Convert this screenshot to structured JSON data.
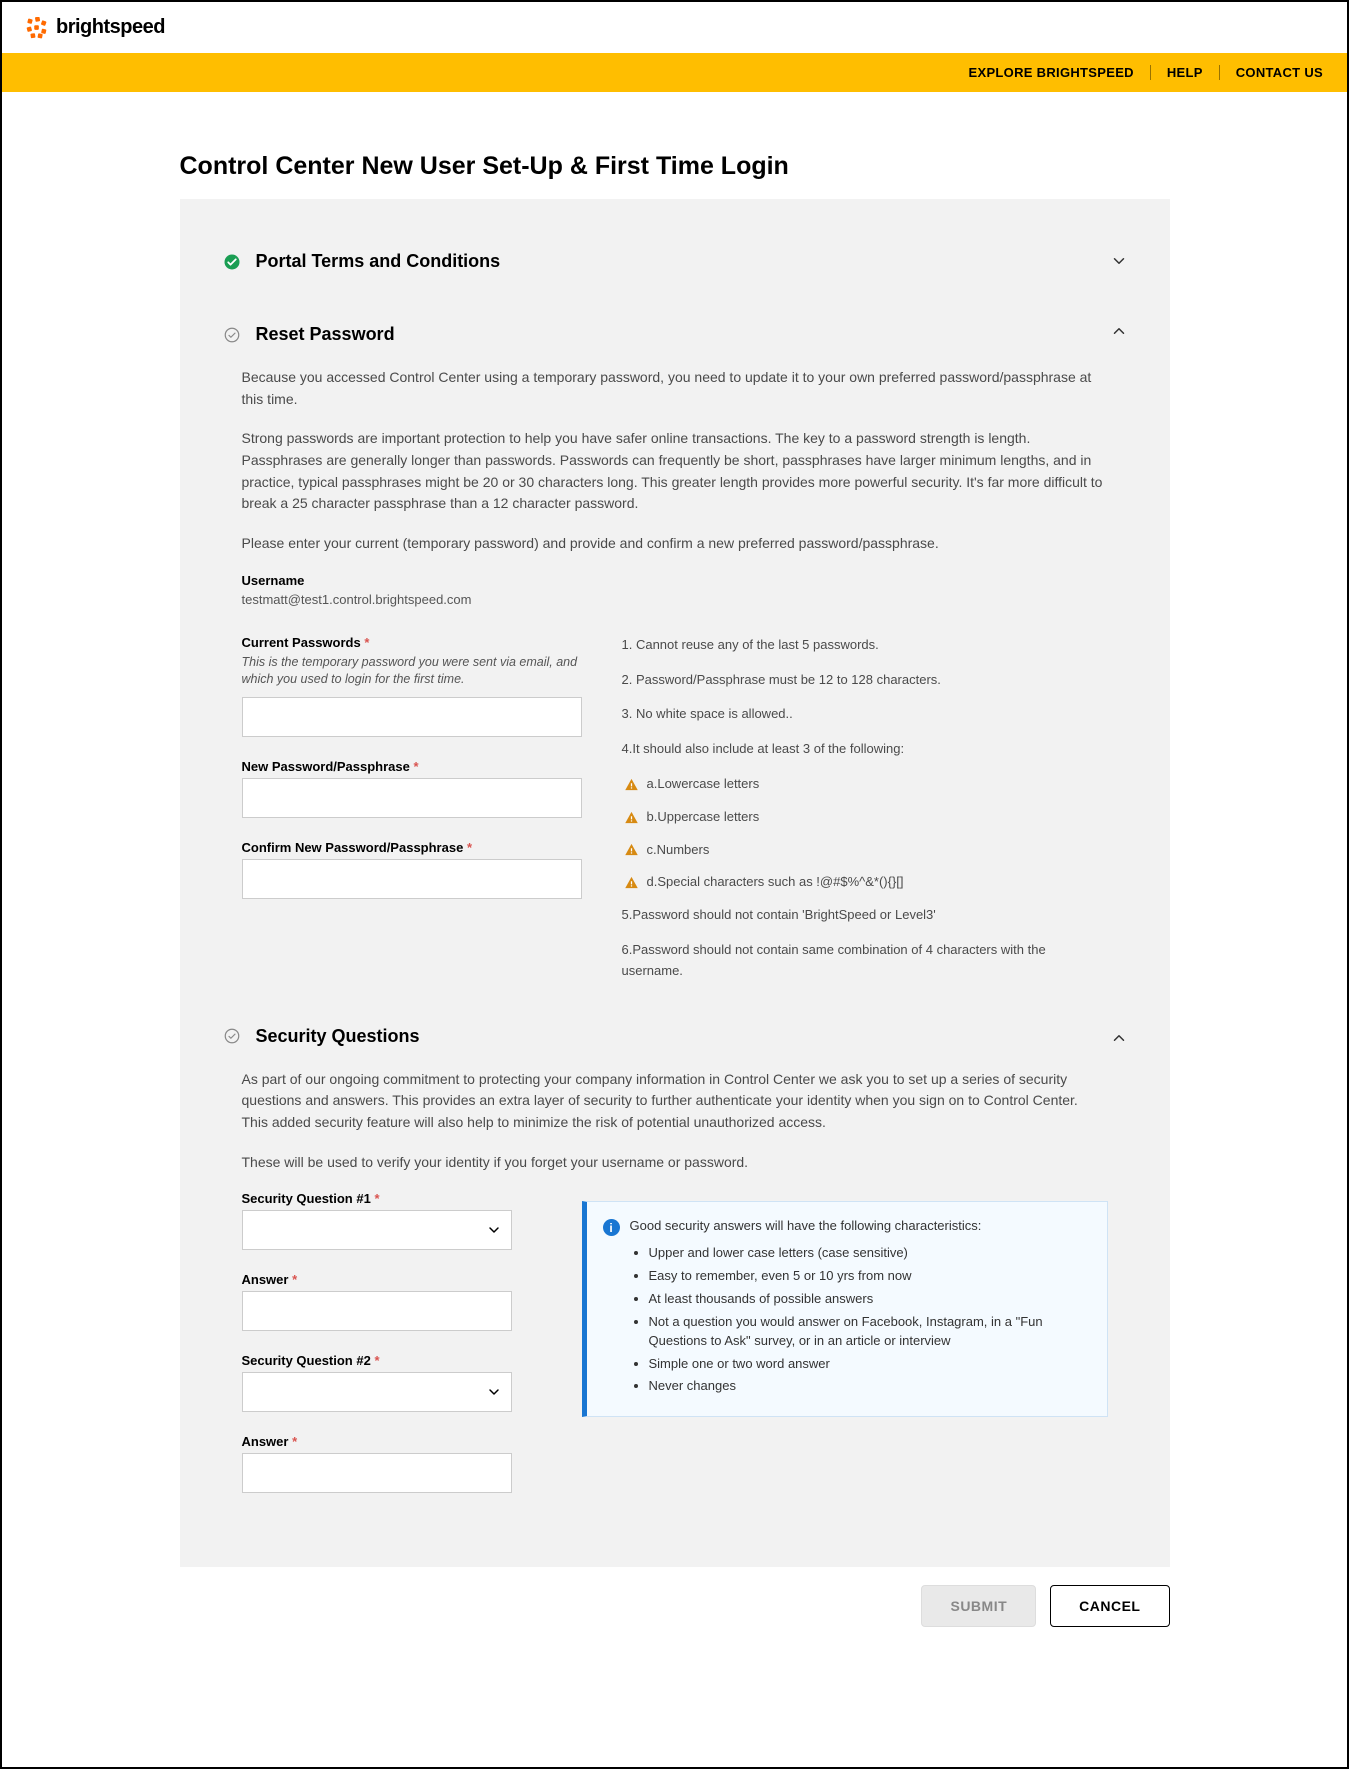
{
  "brand": {
    "name": "brightspeed"
  },
  "nav": {
    "explore": "EXPLORE BRIGHTSPEED",
    "help": "HELP",
    "contact": "CONTACT US"
  },
  "page": {
    "title": "Control Center New User Set-Up & First Time Login"
  },
  "sections": {
    "terms": {
      "title": "Portal Terms and Conditions"
    },
    "reset": {
      "title": "Reset Password",
      "p1": "Because you accessed Control Center using a temporary password, you need to update it to your own preferred password/passphrase at this time.",
      "p2": "Strong passwords are important protection to help you have safer online transactions. The key to a password strength is length. Passphrases are generally longer than passwords. Passwords can frequently be short, passphrases have larger minimum lengths, and in practice, typical passphrases might be 20 or 30 characters long. This greater length provides more powerful security. It's far more difficult to break a 25 character passphrase than a 12 character password.",
      "p3": "Please enter your current (temporary password) and provide and confirm a new preferred password/passphrase.",
      "usernameLabel": "Username",
      "usernameValue": "testmatt@test1.control.brightspeed.com",
      "currentLabel": "Current Passwords",
      "currentHint": "This is the temporary password you were sent via email, and which you used to login for the first time.",
      "newLabel": "New Password/Passphrase",
      "confirmLabel": "Confirm New Password/Passphrase",
      "rules": {
        "r1": "1. Cannot reuse any of the last 5 passwords.",
        "r2": "2. Password/Passphrase must be 12 to 128 characters.",
        "r3": "3. No white space is allowed..",
        "r4": "4.It should also include at least 3 of the following:",
        "r4a": "a.Lowercase letters",
        "r4b": "b.Uppercase letters",
        "r4c": "c.Numbers",
        "r4d": "d.Special characters such as !@#$%^&*(){}[]",
        "r5": "5.Password should not contain 'BrightSpeed or Level3'",
        "r6": "6.Password should not contain same combination of 4 characters with the username."
      }
    },
    "security": {
      "title": "Security Questions",
      "p1": "As part of our ongoing commitment to protecting your company information in Control Center we ask you to set up a series of security questions and answers. This provides an extra layer of security to further authenticate your identity when you sign on to Control Center. This added security feature will also help to minimize the risk of potential unauthorized access.",
      "p2": "These will be used to verify your identity if you forget your username or password.",
      "q1Label": "Security Question #1",
      "a1Label": "Answer",
      "q2Label": "Security Question #2",
      "a2Label": "Answer",
      "infoTitle": "Good security answers will have the following characteristics:",
      "b1": "Upper and lower case letters (case sensitive)",
      "b2": "Easy to remember, even 5 or 10 yrs from now",
      "b3": "At least thousands of possible answers",
      "b4": "Not a question you would answer on Facebook, Instagram, in a \"Fun Questions to Ask\" survey, or in an article or interview",
      "b5": "Simple one or two word answer",
      "b6": "Never changes"
    }
  },
  "actions": {
    "submit": "SUBMIT",
    "cancel": "CANCEL"
  },
  "star": "*"
}
